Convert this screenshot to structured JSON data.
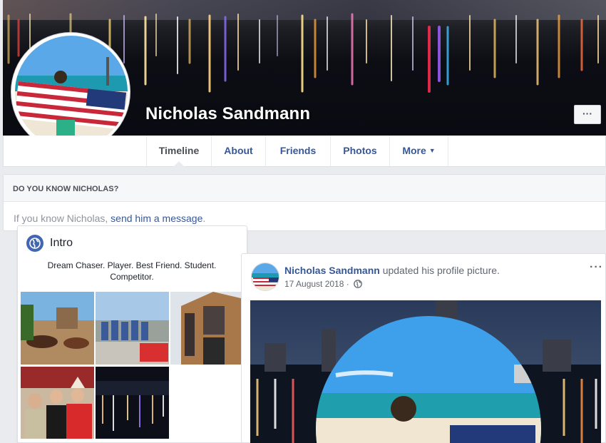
{
  "profile": {
    "name": "Nicholas Sandmann",
    "cover_more_label": "···"
  },
  "nav": {
    "items": [
      {
        "label": "Timeline",
        "active": true
      },
      {
        "label": "About"
      },
      {
        "label": "Friends"
      },
      {
        "label": "Photos"
      },
      {
        "label": "More",
        "dropdown": true
      }
    ],
    "caret": "▼"
  },
  "know": {
    "header": "DO YOU KNOW NICHOLAS?",
    "prefix": "If you know Nicholas, ",
    "link": "send him a message",
    "suffix": "."
  },
  "intro": {
    "icon": "globe-icon",
    "title": "Intro",
    "bio": "Dream Chaser. Player. Best Friend. Student. Competitor."
  },
  "post": {
    "author": "Nicholas Sandmann",
    "action": " updated his profile picture.",
    "date": "17 August 2018 ·",
    "privacy_icon": "globe-icon",
    "menu": "···"
  },
  "colors": {
    "link": "#365899",
    "facebook_blue": "#4267b2",
    "page_bg": "#e9ebee"
  }
}
